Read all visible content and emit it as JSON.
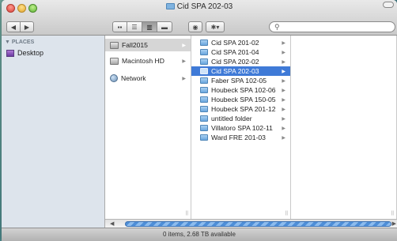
{
  "window": {
    "title": "Cid SPA 202-03"
  },
  "toolbar": {
    "back_label": "◀",
    "forward_label": "▶",
    "view_icons": [
      "▪▪",
      "☰",
      "▥",
      "▬"
    ],
    "eye_icon": "◉",
    "gear_icon": "✱▾",
    "search_glyph": "⚲",
    "search_placeholder": ""
  },
  "sidebar": {
    "header": "▼ PLACES",
    "items": [
      {
        "label": "Desktop",
        "icon": "desktop-icon"
      }
    ]
  },
  "column1": {
    "items": [
      {
        "label": "Fall2015",
        "selected": true,
        "icon": "drive-icon",
        "has_children": true
      },
      {
        "label": "Macintosh HD",
        "selected": false,
        "icon": "drive-icon",
        "has_children": true
      },
      {
        "label": "Network",
        "selected": false,
        "icon": "network-icon",
        "has_children": true
      }
    ]
  },
  "column2": {
    "items": [
      {
        "label": "Cid SPA 201-02",
        "selected": false
      },
      {
        "label": "Cid SPA 201-04",
        "selected": false
      },
      {
        "label": "Cid SPA 202-02",
        "selected": false
      },
      {
        "label": "Cid SPA 202-03",
        "selected": true
      },
      {
        "label": "Faber SPA 102-05",
        "selected": false
      },
      {
        "label": "Houbeck SPA 102-06",
        "selected": false
      },
      {
        "label": "Houbeck SPA 150-05",
        "selected": false
      },
      {
        "label": "Houbeck SPA 201-12",
        "selected": false
      },
      {
        "label": "untitled folder",
        "selected": false
      },
      {
        "label": "Villatoro SPA 102-11",
        "selected": false
      },
      {
        "label": "Ward FRE 201-03",
        "selected": false
      }
    ]
  },
  "statusbar": {
    "text": "0 items, 2.68 TB available"
  },
  "colors": {
    "selection": "#3f7ad7",
    "sidebar_bg": "#dde4ec"
  }
}
